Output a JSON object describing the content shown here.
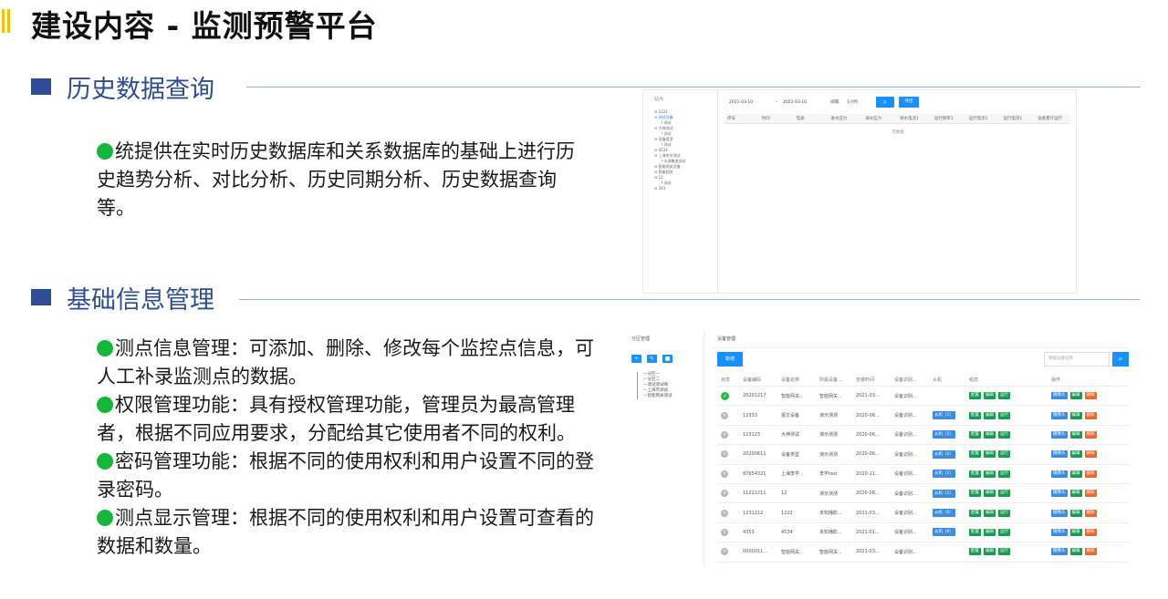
{
  "slide": {
    "title": "建设内容 - 监测预警平台"
  },
  "section1": {
    "heading": "历史数据查询",
    "bullet": "统提供在实时历史数据库和关系数据库的基础上进行历史趋势分析、对比分析、历史同期分析、历史数据查询等。"
  },
  "section2": {
    "heading": "基础信息管理",
    "bullets": [
      "测点信息管理：可添加、删除、修改每个监控点信息，可人工补录监测点的数据。",
      "权限管理功能：具有授权管理功能，管理员为最高管理者，根据不同应用要求，分配给其它使用者不同的权利。",
      "密码管理功能：根据不同的使用权利和用户设置不同的登录密码。",
      "测点显示管理：根据不同的使用权利和用户设置可查看的数据和数量。"
    ]
  },
  "history_ui": {
    "tree_title": "站点",
    "tree": [
      {
        "label": "1222",
        "level": 1,
        "selected": false
      },
      {
        "label": "测试设备",
        "level": 1,
        "selected": true
      },
      {
        "label": "测试",
        "level": 2,
        "selected": false
      },
      {
        "label": "大神测试",
        "level": 1,
        "selected": false
      },
      {
        "label": "测试",
        "level": 2,
        "selected": false
      },
      {
        "label": "设备类型",
        "level": 1,
        "selected": false
      },
      {
        "label": "测试",
        "level": 2,
        "selected": false
      },
      {
        "label": "4534",
        "level": 1,
        "selected": false
      },
      {
        "label": "上海李学测试",
        "level": 1,
        "selected": false
      },
      {
        "label": "水源集变测试",
        "level": 2,
        "selected": false
      },
      {
        "label": "智能网关设备",
        "level": 1,
        "selected": false
      },
      {
        "label": "智能网关",
        "level": 1,
        "selected": false
      },
      {
        "label": "12",
        "level": 1,
        "selected": false
      },
      {
        "label": "测试",
        "level": 2,
        "selected": false
      },
      {
        "label": "343",
        "level": 1,
        "selected": false
      }
    ],
    "start_date": "2021-03-10",
    "end_date": "2021-03-10",
    "interval_label": "间隔:",
    "interval_value": "1小时",
    "query_icon": "search-icon",
    "export_label": "导出",
    "columns": [
      "序号",
      "时间",
      "电表",
      "进水压力",
      "采水压力",
      "进水电流1",
      "运行频率1",
      "运行电流1",
      "运行电流1",
      "设备累计运行"
    ],
    "empty_text": "无数据"
  },
  "device_ui": {
    "left_title": "分区管理",
    "left_buttons": [
      "add-icon",
      "edit-icon",
      "delete-icon"
    ],
    "zones": [
      "分区一",
      "分区二",
      "测试测试啊",
      "上海市测试",
      "智能网关测试"
    ],
    "title": "设备管理",
    "add_label": "新增",
    "search_placeholder": "根据设备名称",
    "columns": [
      "状态",
      "设备编码",
      "设备名称",
      "所属设备...",
      "安装时间",
      "设备识别...",
      "从机",
      "组态",
      "操作"
    ],
    "rows": [
      {
        "status": "online",
        "code": "20201217",
        "name": "智能网关...",
        "owner": "智能网关...",
        "time": "2021-03...",
        "ident": "设备识别...",
        "slave": ""
      },
      {
        "status": "offline",
        "code": "12333",
        "name": "报文设备",
        "owner": "演示测测",
        "time": "2020-06...",
        "ident": "设备识别...",
        "slave": "从机（1）"
      },
      {
        "status": "offline",
        "code": "123123",
        "name": "大神测试",
        "owner": "演示测测",
        "time": "2020-06...",
        "ident": "设备识别...",
        "slave": "从机（1）"
      },
      {
        "status": "offline",
        "code": "20200611",
        "name": "设备类型",
        "owner": "演示测测",
        "time": "2020-06...",
        "ident": "设备识别...",
        "slave": "从机（1）"
      },
      {
        "status": "offline",
        "code": "87654321",
        "name": "上海李学...",
        "owner": "李学test",
        "time": "2020-11...",
        "ident": "设备识别...",
        "slave": "从机（1）"
      },
      {
        "status": "offline",
        "code": "11222211",
        "name": "12",
        "owner": "演示测测",
        "time": "2020-08...",
        "ident": "设备识别...",
        "slave": "从机（1）"
      },
      {
        "status": "offline",
        "code": "1231212",
        "name": "1222",
        "owner": "未知播影...",
        "time": "2021-03...",
        "ident": "设备识别...",
        "slave": "从机（0）"
      },
      {
        "status": "offline",
        "code": "4353",
        "name": "4534",
        "owner": "未知播影...",
        "time": "2021-01...",
        "ident": "设备识别...",
        "slave": "从机（0）"
      },
      {
        "status": "offline",
        "code": "0000011...",
        "name": "智能网关...",
        "owner": "智能网关...",
        "time": "2021-03...",
        "ident": "设备识别...",
        "slave": ""
      }
    ],
    "config_buttons": [
      "配置",
      "编辑",
      "运行"
    ],
    "action_buttons": [
      "摄像头",
      "编辑",
      "删除"
    ]
  }
}
